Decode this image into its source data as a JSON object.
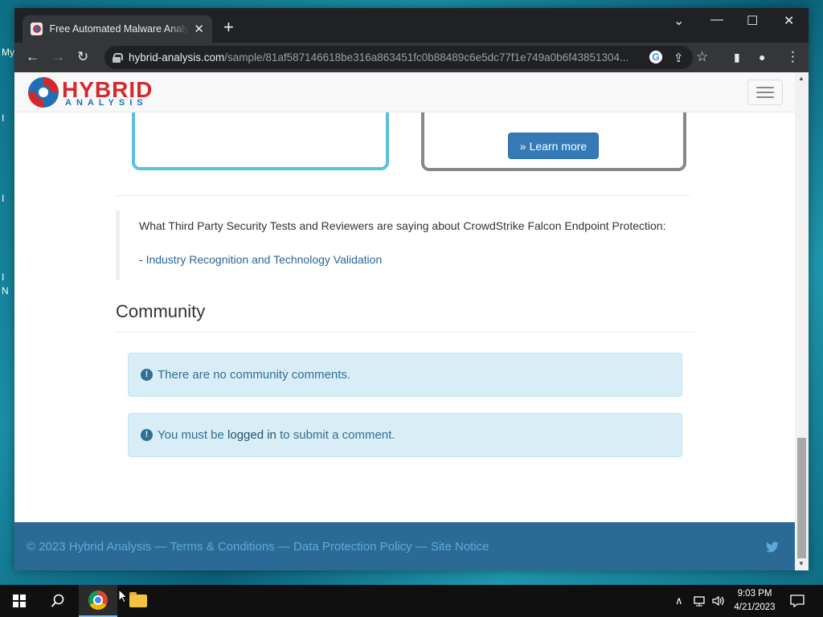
{
  "desktop": {
    "fragments": [
      "My",
      "I",
      "I",
      "I",
      "N"
    ]
  },
  "browser": {
    "tab_title": "Free Automated Malware Analysis Service",
    "new_tab": "+",
    "window_controls": {
      "dropdown": "⌄",
      "minimize": "—",
      "maximize": "☐",
      "close": "✕"
    },
    "toolbar": {
      "back": "←",
      "forward": "→",
      "reload": "↻"
    },
    "url_host": "hybrid-analysis.com",
    "url_path": "/sample/81af587146618be316a863451fc0b88489c6e5dc77f1e749a0b6f43851304...",
    "omnibox_icons": {
      "google": "G",
      "share": "⇪",
      "bookmark": "☆"
    },
    "side_icons": {
      "sidepanel": "▮",
      "profile": "●",
      "menu": "⋮"
    }
  },
  "site": {
    "logo": {
      "word1": "HYBRID",
      "word2": "ANALYSIS"
    },
    "learn_more": "Learn more",
    "third_party_text": "What Third Party Security Tests and Reviewers are saying about CrowdStrike Falcon Endpoint Protection:",
    "link_prefix": "- ",
    "link_text": "Industry Recognition and Technology Validation",
    "community_heading": "Community",
    "alert_no_comments": "There are no community comments.",
    "alert_login_prefix": "You must be ",
    "alert_login_link": "logged in",
    "alert_login_suffix": " to submit a comment.",
    "footer": {
      "copyright": "© 2023 Hybrid Analysis",
      "sep": " — ",
      "terms": "Terms & Conditions",
      "privacy": "Data Protection Policy",
      "notice": "Site Notice"
    }
  },
  "taskbar": {
    "time": "9:03 PM",
    "date": "4/21/2023"
  },
  "colors": {
    "accent": "#337ab7",
    "alert_bg": "#d9edf7",
    "footer_bg": "#2c6a96",
    "logo_red": "#d4292c",
    "logo_blue": "#1f6fb4"
  }
}
